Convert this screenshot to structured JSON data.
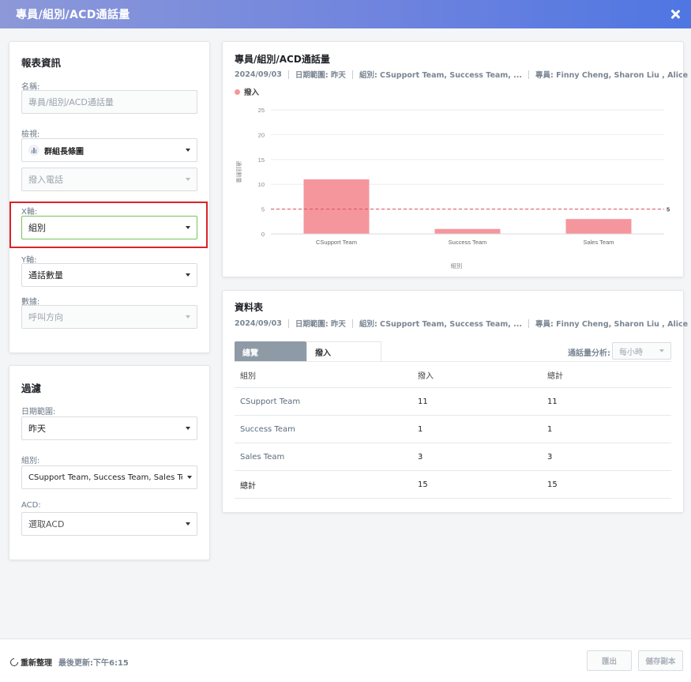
{
  "header": {
    "title": "專員/組別/ACD通話量"
  },
  "report_info": {
    "section_title": "報表資訊",
    "name_label": "名稱:",
    "name_placeholder": "專員/組別/ACD通話量",
    "view_label": "檢視:",
    "view_value": "群組長條圖",
    "view_sub_value": "撥入電話",
    "xaxis_label": "X軸:",
    "xaxis_value": "組別",
    "yaxis_label": "Y軸:",
    "yaxis_value": "通話數量",
    "data_label": "數據:",
    "data_value": "呼叫方向"
  },
  "filter": {
    "section_title": "過濾",
    "date_label": "日期範圍:",
    "date_value": "昨天",
    "group_label": "組別:",
    "group_value": "CSupport Team, Success Team, Sales Team",
    "acd_label": "ACD:",
    "acd_value": "選取ACD"
  },
  "chart_panel": {
    "title": "專員/組別/ACD通話量",
    "meta": {
      "date": "2024/09/03",
      "range": "日期範圍: 昨天",
      "groups": "組別: CSupport Team, Success Team, ...",
      "agents": "專員: Finny Cheng, Sharon Liu , Alice C..."
    }
  },
  "chart_data": {
    "type": "bar",
    "categories": [
      "CSupport Team",
      "Success Team",
      "Sales Team"
    ],
    "series": [
      {
        "name": "撥入",
        "values": [
          11,
          1,
          3
        ],
        "color": "#f5969d"
      }
    ],
    "xlabel": "組別",
    "ylabel": "通話數量",
    "ylim": [
      0,
      25
    ],
    "yticks": [
      0,
      5,
      10,
      15,
      20,
      25
    ],
    "reference_line": {
      "value": 5,
      "label": "5",
      "color": "#e0505a",
      "style": "dashed"
    },
    "grid": true,
    "legend": "top-left"
  },
  "table_panel": {
    "title": "資料表",
    "meta": {
      "date": "2024/09/03",
      "range": "日期範圍: 昨天",
      "groups": "組別: CSupport Team, Success Team, ...",
      "agents": "專員: Finny Cheng, Sharon Liu , Alice C..."
    },
    "tabs": [
      {
        "label": "總覽"
      },
      {
        "label": "撥入"
      }
    ],
    "analysis_label": "通話量分析:",
    "analysis_value": "每小時",
    "columns": [
      "組別",
      "撥入",
      "總計"
    ],
    "rows": [
      {
        "group": "CSupport Team",
        "inbound": "11",
        "total": "11"
      },
      {
        "group": "Success Team",
        "inbound": "1",
        "total": "1"
      },
      {
        "group": "Sales Team",
        "inbound": "3",
        "total": "3"
      }
    ],
    "total_row": {
      "label": "總計",
      "inbound": "15",
      "total": "15"
    }
  },
  "footer": {
    "refresh_label": "重新整理",
    "last_updated": "最後更新:下午6:15",
    "export_label": "匯出",
    "save_copy_label": "儲存副本"
  }
}
